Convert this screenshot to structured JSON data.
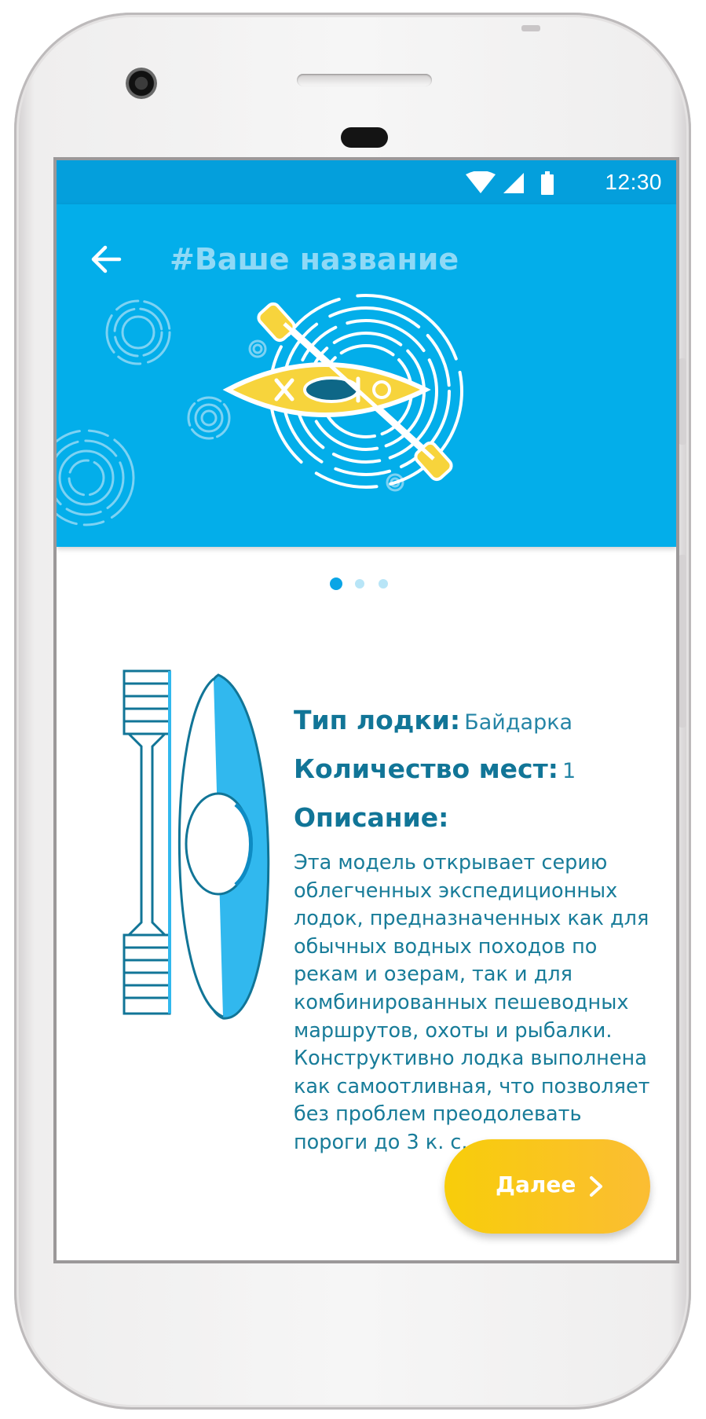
{
  "status_bar": {
    "time": "12:30",
    "icons": [
      "wifi-icon",
      "signal-icon",
      "battery-icon"
    ]
  },
  "toolbar": {
    "back_icon": "arrow-left-icon",
    "title": "#Ваше название"
  },
  "pager": {
    "total": 3,
    "active_index": 0
  },
  "boat": {
    "type_label": "Тип лодки:",
    "type_value": "Байдарка",
    "seats_label": "Количество мест:",
    "seats_value": "1",
    "description_label": "Описание:",
    "description": "Эта модель открывает серию облегченных экспедиционных лодок, предназначенных как для обычных водных походов по рекам и озерам, так и для комбинированных пешеводных маршрутов, охоты и рыбалки. Конструктивно лодка выполнена как самоотливная, что позволяет без проблем преодолевать пороги до 3 к. с."
  },
  "next_button": {
    "label": "Далее",
    "icon": "chevron-right-icon"
  },
  "colors": {
    "primary": "#03aeea",
    "status_bar": "#049fdc",
    "title_text": "#8fd9f6",
    "info_text": "#117597",
    "accent_start": "#f8cd0a",
    "accent_end": "#fbbd33",
    "kayak_yellow": "#f7d43c"
  }
}
